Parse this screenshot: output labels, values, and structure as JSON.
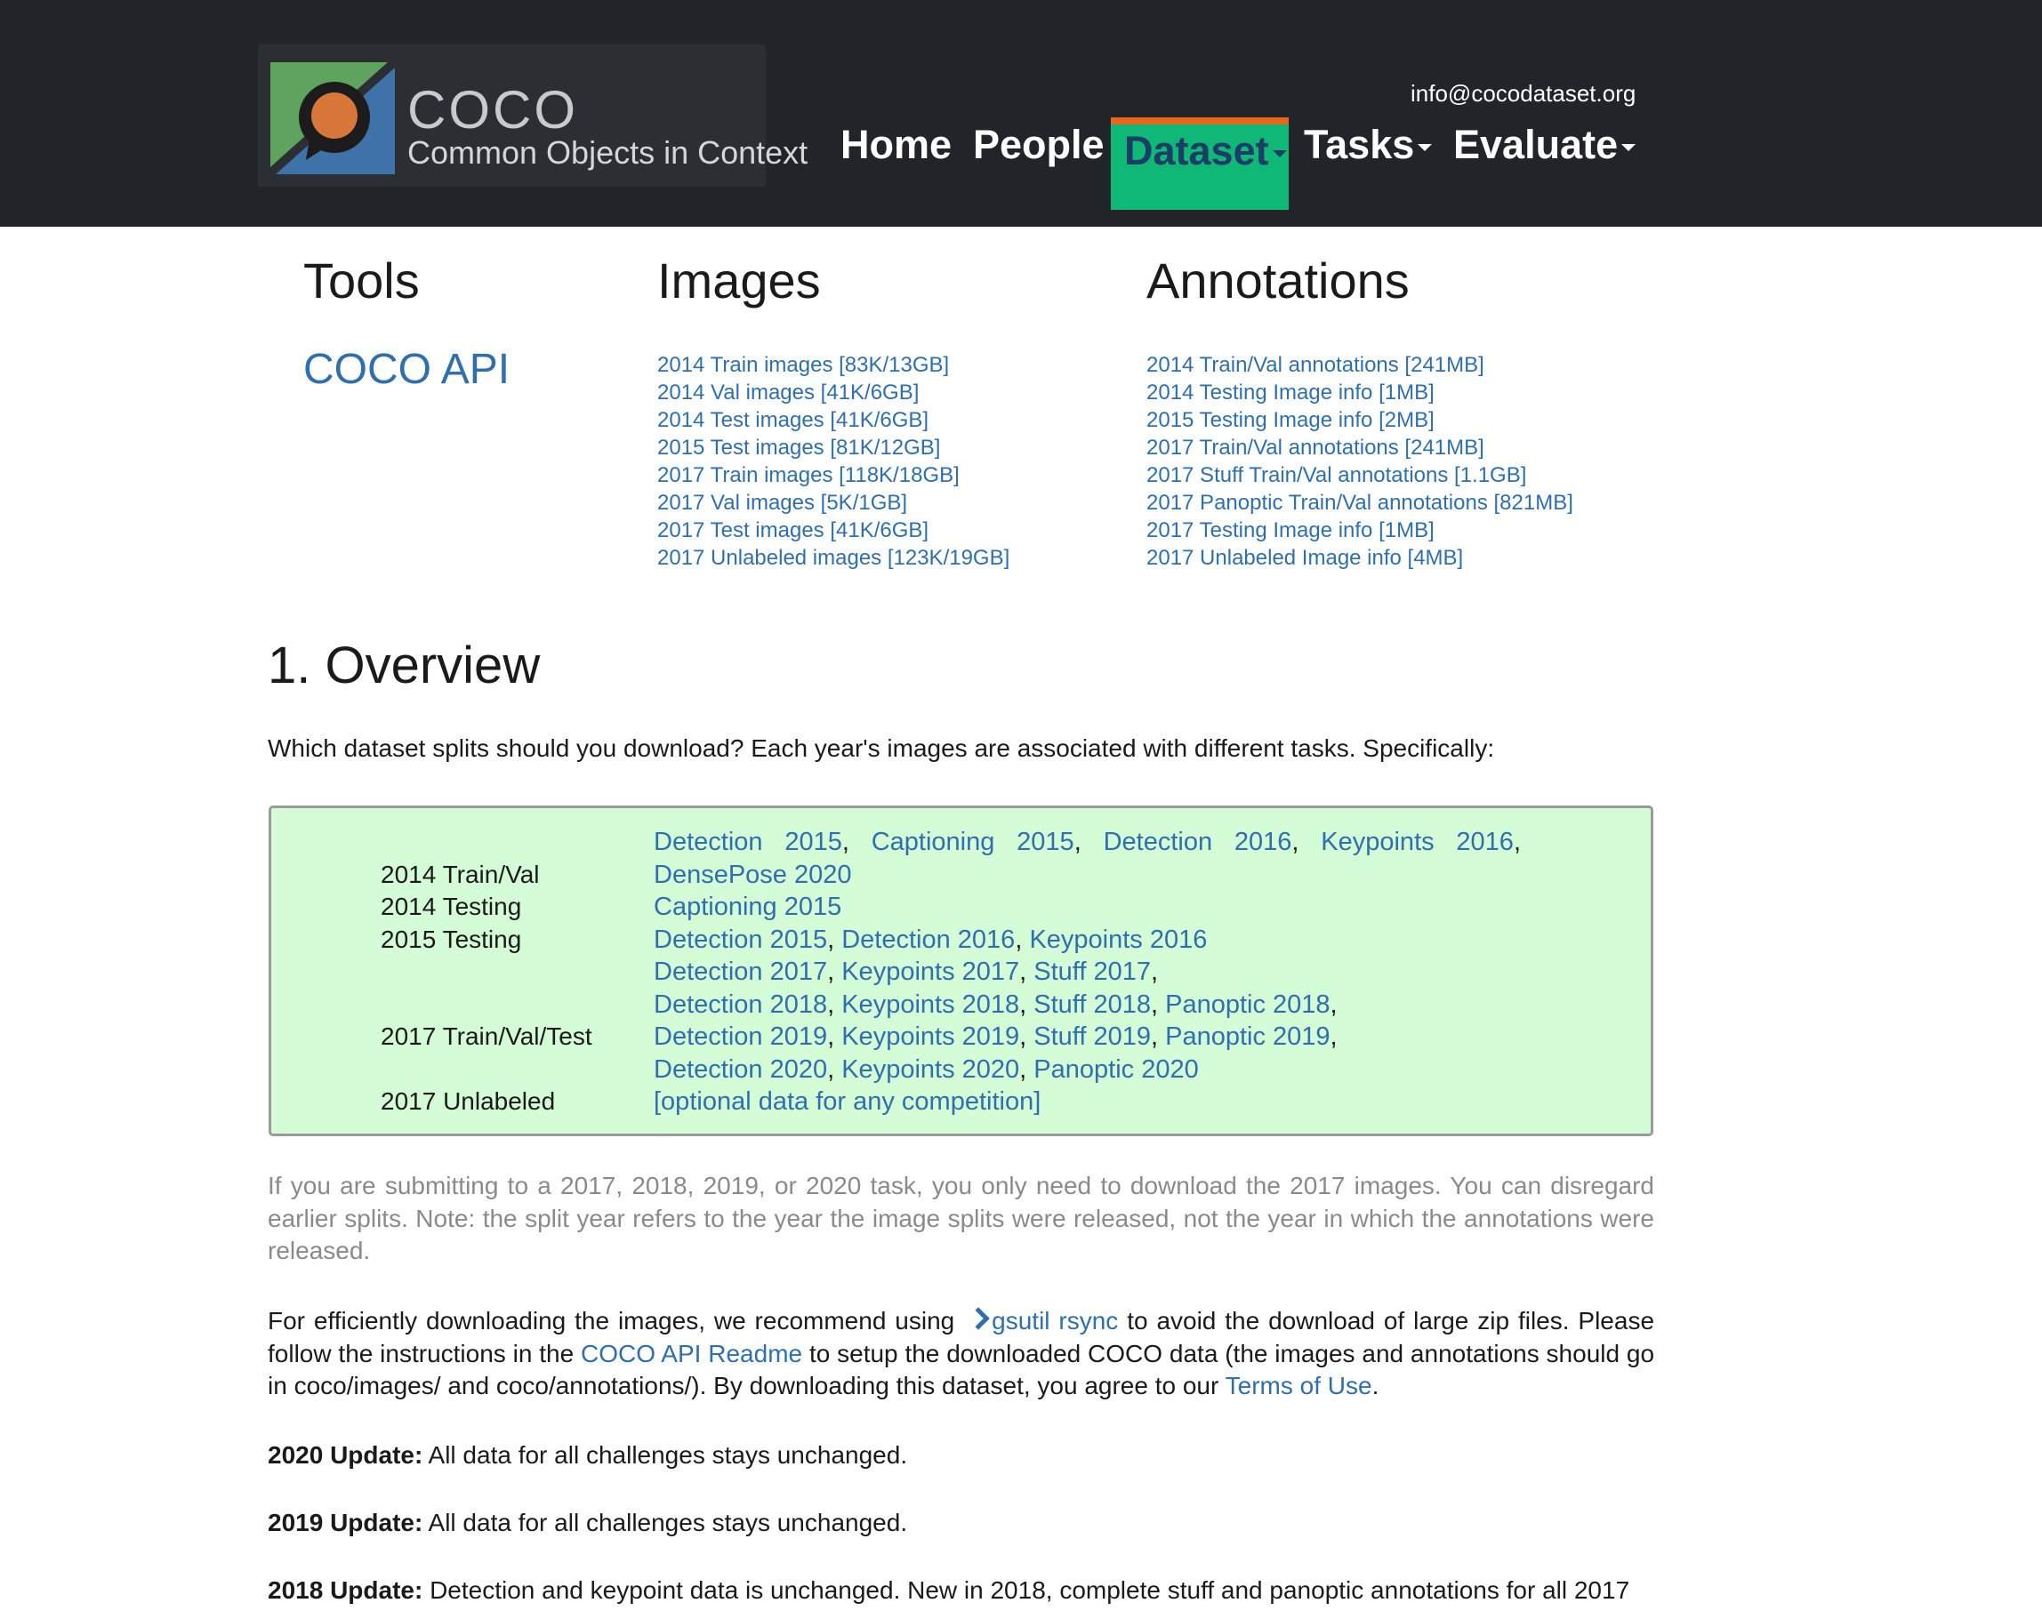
{
  "header": {
    "logo_title": "COCO",
    "logo_tagline": "Common Objects in Context",
    "email": "info@cocodataset.org",
    "nav": [
      {
        "label": "Home"
      },
      {
        "label": "People"
      },
      {
        "label": "Dataset",
        "active": true
      },
      {
        "label": "Tasks"
      },
      {
        "label": "Evaluate"
      }
    ],
    "active_color": "#0fb877",
    "active_border_color": "#e8671a"
  },
  "downloads": {
    "tools_title": "Tools",
    "images_title": "Images",
    "annotations_title": "Annotations",
    "tools": [
      "COCO API"
    ],
    "images": [
      "2014 Train images [83K/13GB]",
      "2014 Val images [41K/6GB]",
      "2014 Test images [41K/6GB]",
      "2015 Test images [81K/12GB]",
      "2017 Train images [118K/18GB]",
      "2017 Val images [5K/1GB]",
      "2017 Test images [41K/6GB]",
      "2017 Unlabeled images [123K/19GB]"
    ],
    "annotations": [
      "2014 Train/Val annotations [241MB]",
      "2014 Testing Image info [1MB]",
      "2015 Testing Image info [2MB]",
      "2017 Train/Val annotations [241MB]",
      "2017 Stuff Train/Val annotations [1.1GB]",
      "2017 Panoptic Train/Val annotations [821MB]",
      "2017 Testing Image info [1MB]",
      "2017 Unlabeled Image info [4MB]"
    ]
  },
  "overview": {
    "title": "1. Overview",
    "intro": "Which dataset splits should you download? Each year's images are associated with different tasks. Specifically:",
    "splits": {
      "train_val_2014": "2014 Train/Val",
      "testing_2014": "2014 Testing",
      "testing_2015": "2015 Testing",
      "train_val_test_2017": "2017 Train/Val/Test",
      "unlabeled_2017": "2017 Unlabeled"
    },
    "tasks": {
      "det2015": "Detection 2015",
      "cap2015": "Captioning 2015",
      "det2016": "Detection 2016",
      "kp2016": "Keypoints 2016",
      "dp2020": "DensePose 2020",
      "det2017": "Detection 2017",
      "kp2017": "Keypoints 2017",
      "stuff2017": "Stuff 2017",
      "det2018": "Detection 2018",
      "kp2018": "Keypoints 2018",
      "stuff2018": "Stuff 2018",
      "pan2018": "Panoptic 2018",
      "det2019": "Detection 2019",
      "kp2019": "Keypoints 2019",
      "stuff2019": "Stuff 2019",
      "pan2019": "Panoptic 2019",
      "det2020": "Detection 2020",
      "kp2020": "Keypoints 2020",
      "pan2020": "Panoptic 2020",
      "optional": "[optional data for any competition]"
    },
    "box_color": "#d4fcd6",
    "note": "If you are submitting to a 2017, 2018, 2019, or 2020 task, you only need to download the 2017 images. You can disregard earlier splits. Note: the split year refers to the year the image splits were released, not the year in which the annotations were released.",
    "gsutil": {
      "before": "For efficiently downloading the images, we recommend using",
      "link": "gsutil rsync",
      "mid1": "to avoid the download of large zip files. Please follow the instructions in the",
      "readme_link": "COCO API Readme",
      "mid2": "to setup the downloaded COCO data (the images and annotations should go in coco/images/ and coco/annotations/). By downloading this dataset, you agree to our",
      "terms_link": "Terms of Use",
      "end": "."
    },
    "updates": [
      {
        "label": "2020 Update:",
        "text": "All data for all challenges stays unchanged."
      },
      {
        "label": "2019 Update:",
        "text": "All data for all challenges stays unchanged."
      },
      {
        "label": "2018 Update:",
        "text": "Detection and keypoint data is unchanged. New in 2018, complete stuff and panoptic annotations for all 2017"
      }
    ]
  }
}
